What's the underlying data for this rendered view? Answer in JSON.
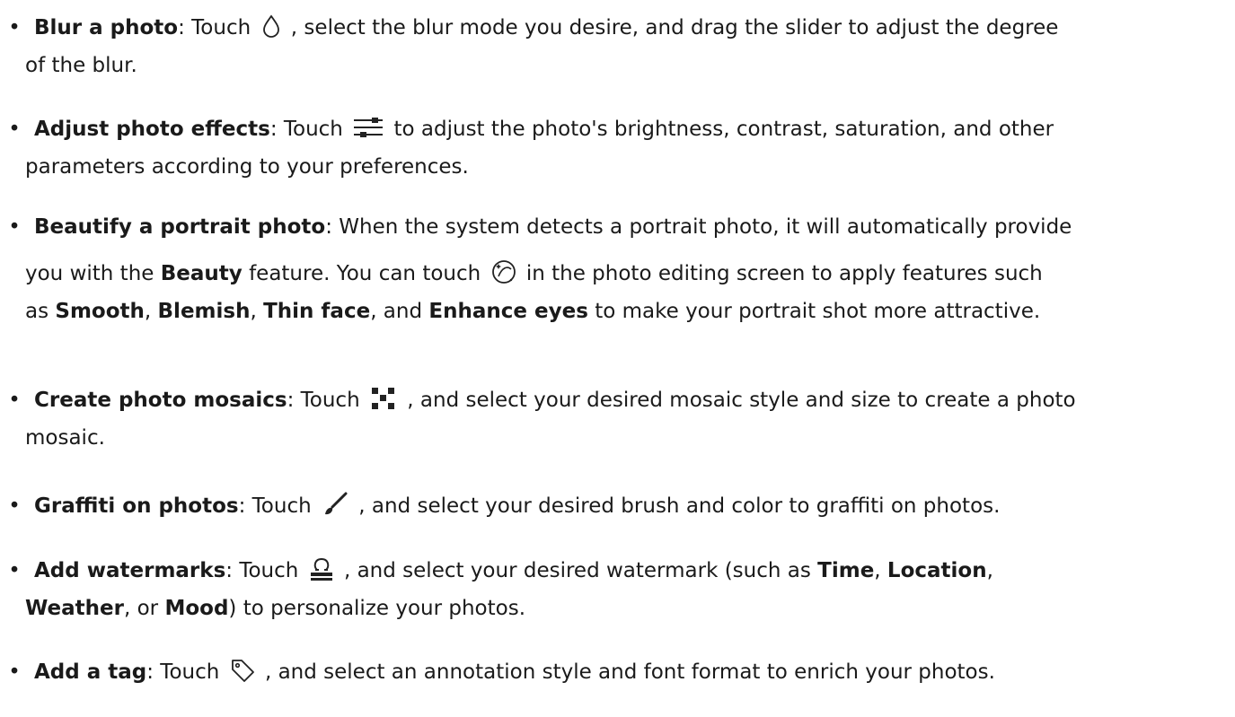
{
  "bullet_char": "•",
  "items": [
    {
      "term": "Blur a photo",
      "l1a": ": Touch ",
      "icon": "droplet-icon",
      "l1b": " , select the blur mode you desire, and drag the slider to adjust the degree",
      "l2": "of the blur."
    },
    {
      "term": "Adjust photo effects",
      "l1a": ": Touch ",
      "icon": "sliders-icon",
      "l1b": " to adjust the photo's brightness, contrast, saturation, and other",
      "l2": "parameters according to your preferences."
    },
    {
      "term": "Beautify a portrait photo",
      "l1a": ": When the system detects a portrait photo, it will automatically provide",
      "l2a": "you with the ",
      "kw1": "Beauty",
      "l2b": " feature. You can touch ",
      "icon": "beauty-face-icon",
      "l2c": " in the photo editing screen to apply features such",
      "l3a": "as ",
      "kw2": "Smooth",
      "l3b": ", ",
      "kw3": "Blemish",
      "l3c": ", ",
      "kw4": "Thin face",
      "l3d": ", and ",
      "kw5": "Enhance eyes",
      "l3e": " to make your portrait shot more attractive."
    },
    {
      "term": "Create photo mosaics",
      "l1a": ": Touch ",
      "icon": "mosaic-icon",
      "l1b": " , and select your desired mosaic style and size to create a photo",
      "l2": "mosaic."
    },
    {
      "term": "Graffiti on photos",
      "l1a": ": Touch ",
      "icon": "brush-icon",
      "l1b": " , and select your desired brush and color to graffiti on photos."
    },
    {
      "term": "Add watermarks",
      "l1a": ": Touch ",
      "icon": "watermark-icon",
      "l1b": " , and select your desired watermark (such as ",
      "kw1": "Time",
      "l1c": ", ",
      "kw2": "Location",
      "l1d": ",",
      "l2kw": "Weather",
      "l2a": ", or ",
      "l2kw2": "Mood",
      "l2b": ") to personalize your photos."
    },
    {
      "term": "Add a tag",
      "l1a": ": Touch ",
      "icon": "tag-icon",
      "l1b": " , and select an annotation style and font format to enrich your photos."
    }
  ]
}
